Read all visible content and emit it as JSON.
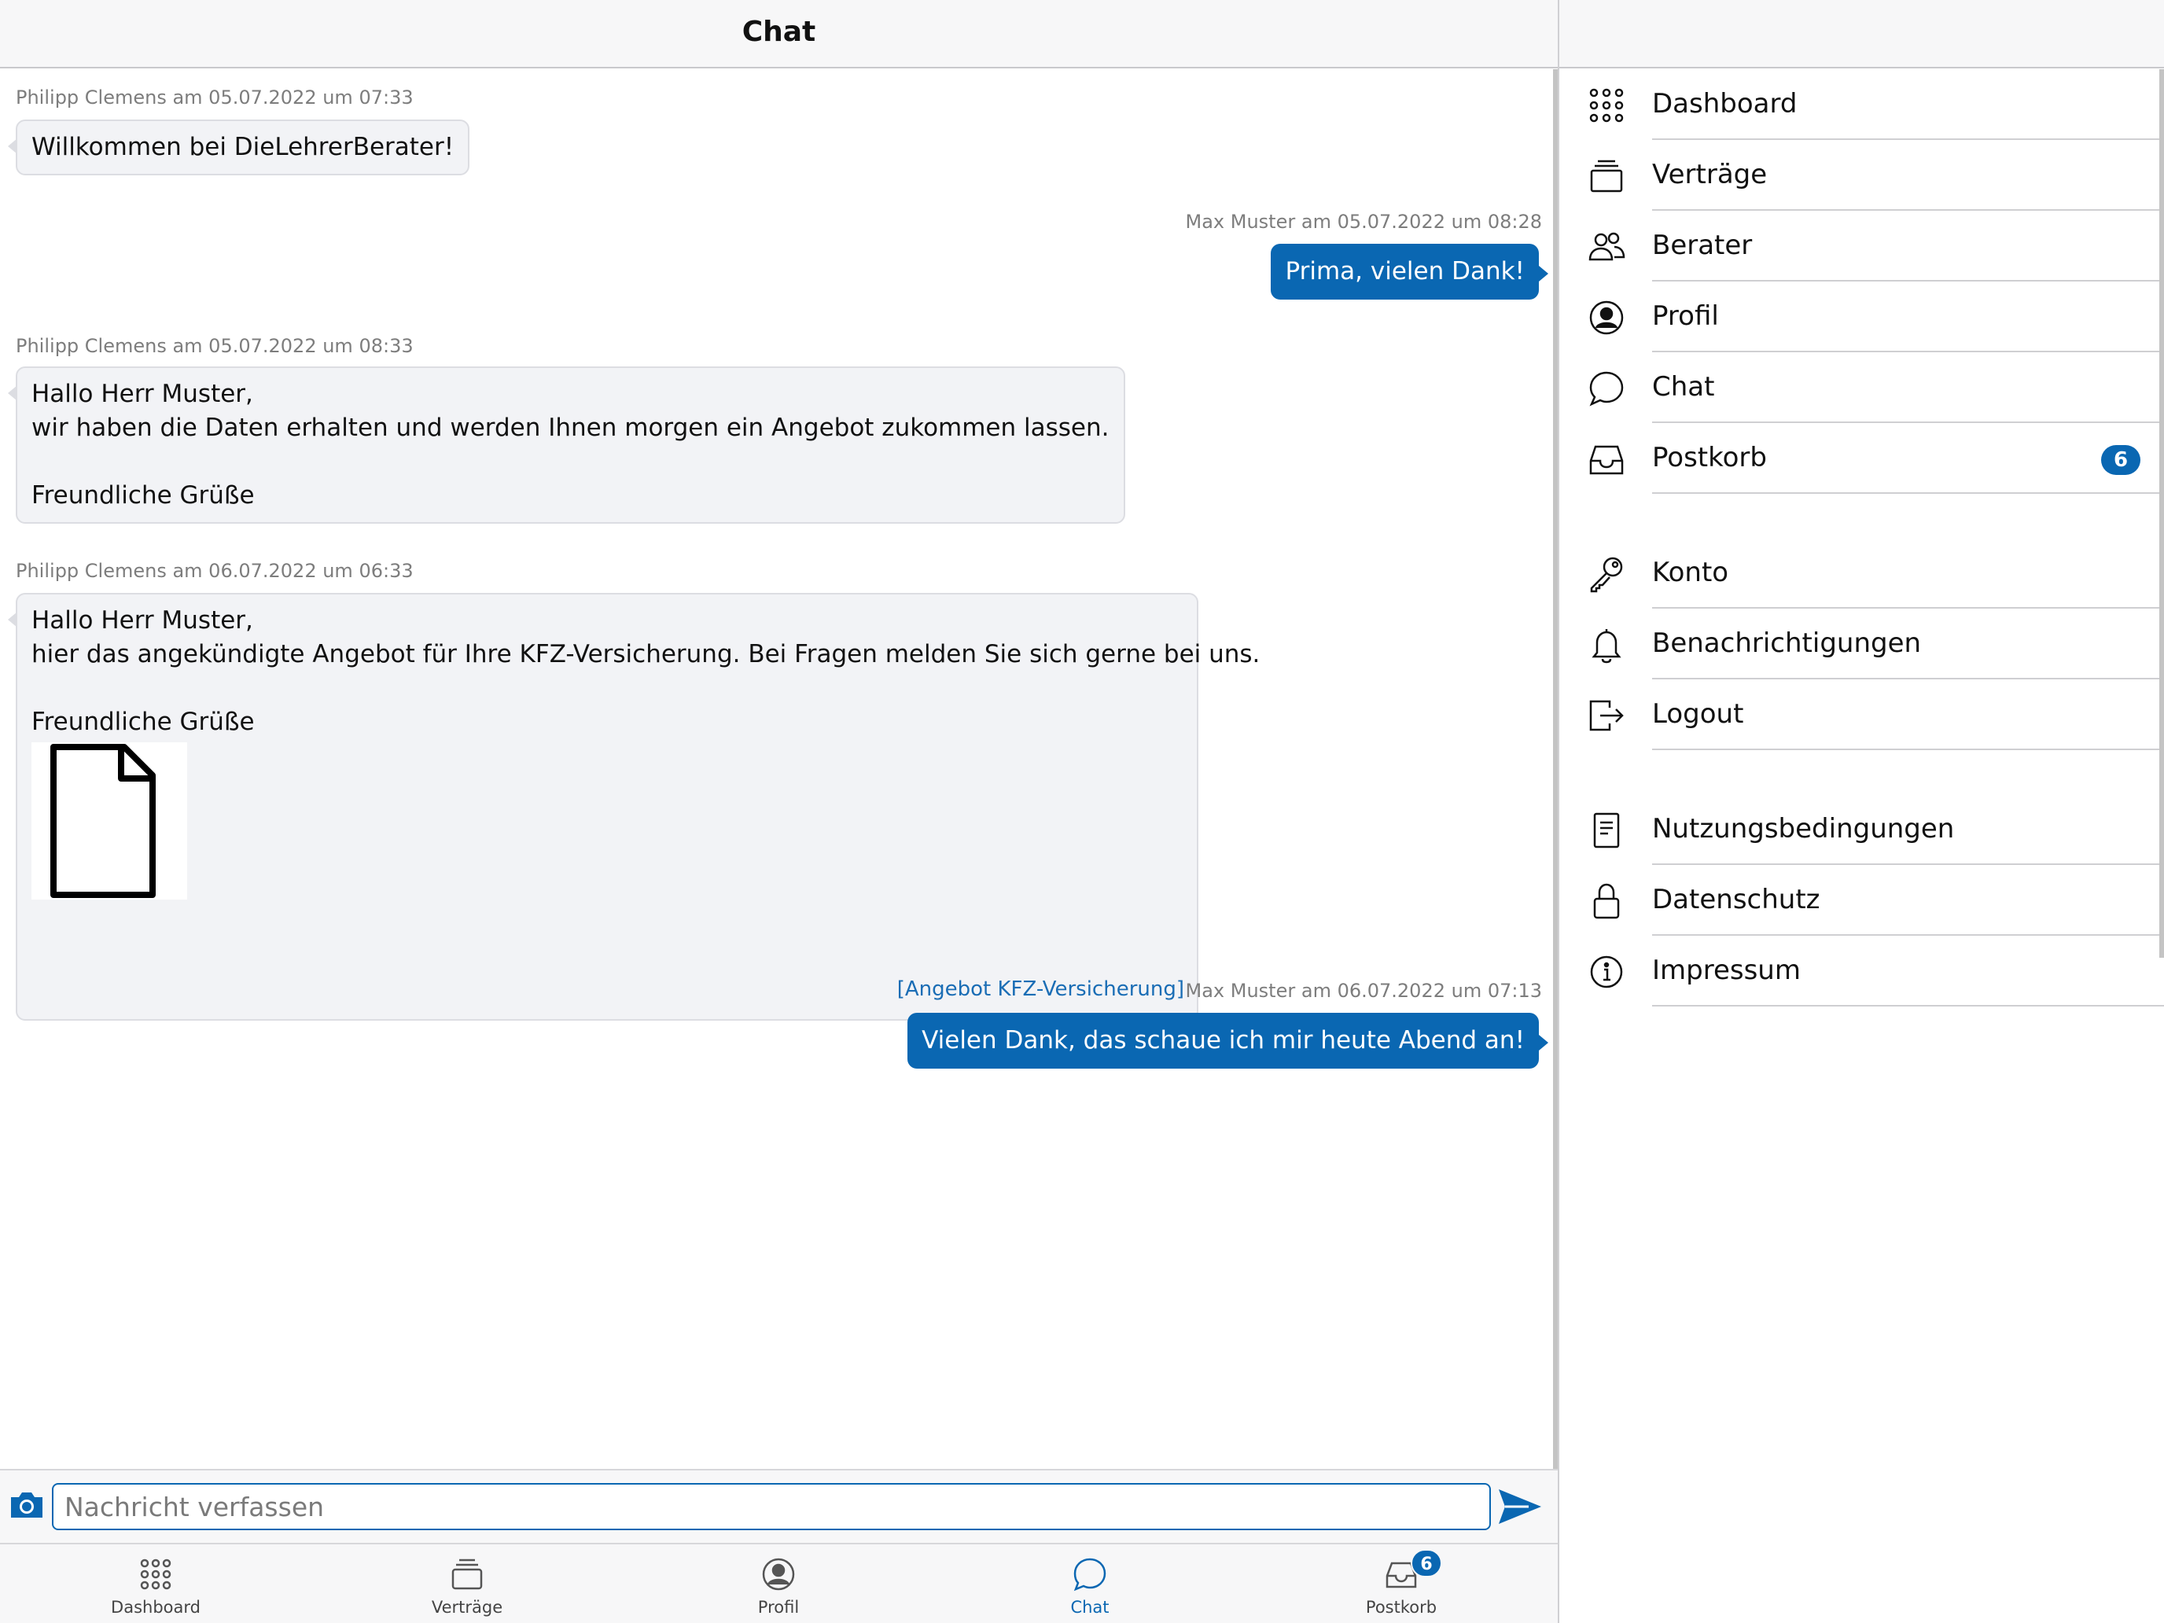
{
  "header": {
    "title": "Chat"
  },
  "messages": [
    {
      "direction": "in",
      "meta": "Philipp Clemens am 05.07.2022 um 07:33",
      "lines": [
        "Willkommen bei DieLehrerBerater!"
      ]
    },
    {
      "direction": "out",
      "meta": "Max Muster am 05.07.2022 um 08:28",
      "lines": [
        "Prima, vielen Dank!"
      ]
    },
    {
      "direction": "in",
      "meta": "Philipp Clemens am 05.07.2022 um 08:33",
      "lines": [
        "Hallo Herr Muster,",
        "wir haben die Daten erhalten und werden Ihnen morgen ein Angebot zukommen lassen.",
        "",
        "Freundliche Grüße"
      ]
    },
    {
      "direction": "in",
      "meta": "Philipp Clemens am 06.07.2022 um 06:33",
      "lines": [
        "Hallo Herr Muster,",
        "hier das angekündigte Angebot für Ihre KFZ-Versicherung. Bei Fragen melden Sie sich gerne bei uns.",
        "",
        "Freundliche Grüße"
      ],
      "attachment": {
        "icon": "document-icon",
        "link": "[Angebot KFZ-Versicherung]"
      }
    },
    {
      "direction": "out",
      "meta": "Max Muster am 06.07.2022 um 07:13",
      "lines": [
        "Vielen Dank, das schaue ich mir heute Abend an!"
      ]
    }
  ],
  "composer": {
    "placeholder": "Nachricht verfassen",
    "camera_icon": "camera-icon",
    "send_icon": "send-icon"
  },
  "tabs": [
    {
      "label": "Dashboard",
      "icon": "grid-icon",
      "active": false
    },
    {
      "label": "Verträge",
      "icon": "stack-icon",
      "active": false
    },
    {
      "label": "Profil",
      "icon": "user-circle-icon",
      "active": false
    },
    {
      "label": "Chat",
      "icon": "chat-bubble-icon",
      "active": true
    },
    {
      "label": "Postkorb",
      "icon": "inbox-icon",
      "active": false,
      "badge": "6"
    }
  ],
  "menu": {
    "items": [
      {
        "label": "Dashboard",
        "icon": "grid-icon"
      },
      {
        "label": "Verträge",
        "icon": "stack-icon"
      },
      {
        "label": "Berater",
        "icon": "people-icon"
      },
      {
        "label": "Profil",
        "icon": "user-circle-icon"
      },
      {
        "label": "Chat",
        "icon": "chat-bubble-icon"
      },
      {
        "label": "Postkorb",
        "icon": "inbox-icon",
        "badge": "6"
      },
      {
        "label": "Konto",
        "icon": "key-icon"
      },
      {
        "label": "Benachrichtigungen",
        "icon": "bell-icon"
      },
      {
        "label": "Logout",
        "icon": "logout-icon"
      },
      {
        "label": "Nutzungsbedingungen",
        "icon": "document-lines-icon"
      },
      {
        "label": "Datenschutz",
        "icon": "lock-icon"
      },
      {
        "label": "Impressum",
        "icon": "info-icon"
      }
    ]
  },
  "colors": {
    "accent": "#0a67b2",
    "incoming_bubble": "#f2f3f6",
    "meta_text": "#7d7d7d"
  }
}
